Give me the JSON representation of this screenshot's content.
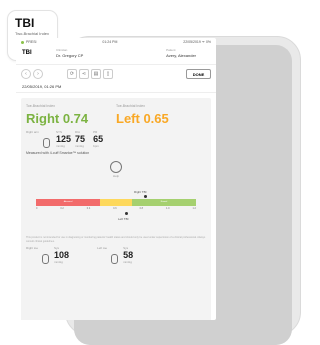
{
  "app_icon": {
    "title": "TBI",
    "subtitle": "Two-Brachial Index"
  },
  "status_bar": {
    "carrier": "PRESI",
    "time": "01:24 PM",
    "right": "22/05/2019 ᯤ 0%"
  },
  "header": {
    "title": "TBI",
    "clinician_label": "Clinician",
    "clinician_value": "Dr. Gregory CP",
    "patient_label": "Patient",
    "patient_value": "Avery, Alexander"
  },
  "toolbar": {
    "done_label": "DONE"
  },
  "date": "22/05/2019, 01:26 PM",
  "results": {
    "right_label": "Toe-Brachial Index",
    "left_label": "Toe-Brachial Index",
    "right_value": "Right 0.74",
    "left_value": "Left 0.65"
  },
  "metrics": {
    "right_arm": "Right arm",
    "sys_label": "SYS",
    "sys_value": "125",
    "sys_unit": "mmHg",
    "dia_label": "DIA",
    "dia_value": "75",
    "dia_unit": "mmHg",
    "pr_label": "PR",
    "pr_value": "65",
    "pr_unit": "bpm"
  },
  "measured": "Measured with 4-cuff Smartoe™ solution",
  "help_label": "Help",
  "scale": {
    "right_tbi": "Right TBI",
    "left_tbi": "Left TBI",
    "abnormal": "Abnormal",
    "normal": "Normal",
    "ticks": [
      "0",
      "0.2",
      "0.4",
      "0.6",
      "0.8",
      "1.0",
      "1.2"
    ]
  },
  "disclaimer": "This product is not intended for use in diagnosing or monitoring patients' health status and should only be used under supervision of a clinical professional. Always consult clinical guidelines.",
  "bottom": {
    "right_toe": "Right toe",
    "right_sys_label": "Sys",
    "right_sys_value": "108",
    "right_sys_unit": "mmHg",
    "left_toe": "Left toe",
    "left_sys_label": "Sys",
    "left_sys_value": "58",
    "left_sys_unit": "mmHg"
  }
}
